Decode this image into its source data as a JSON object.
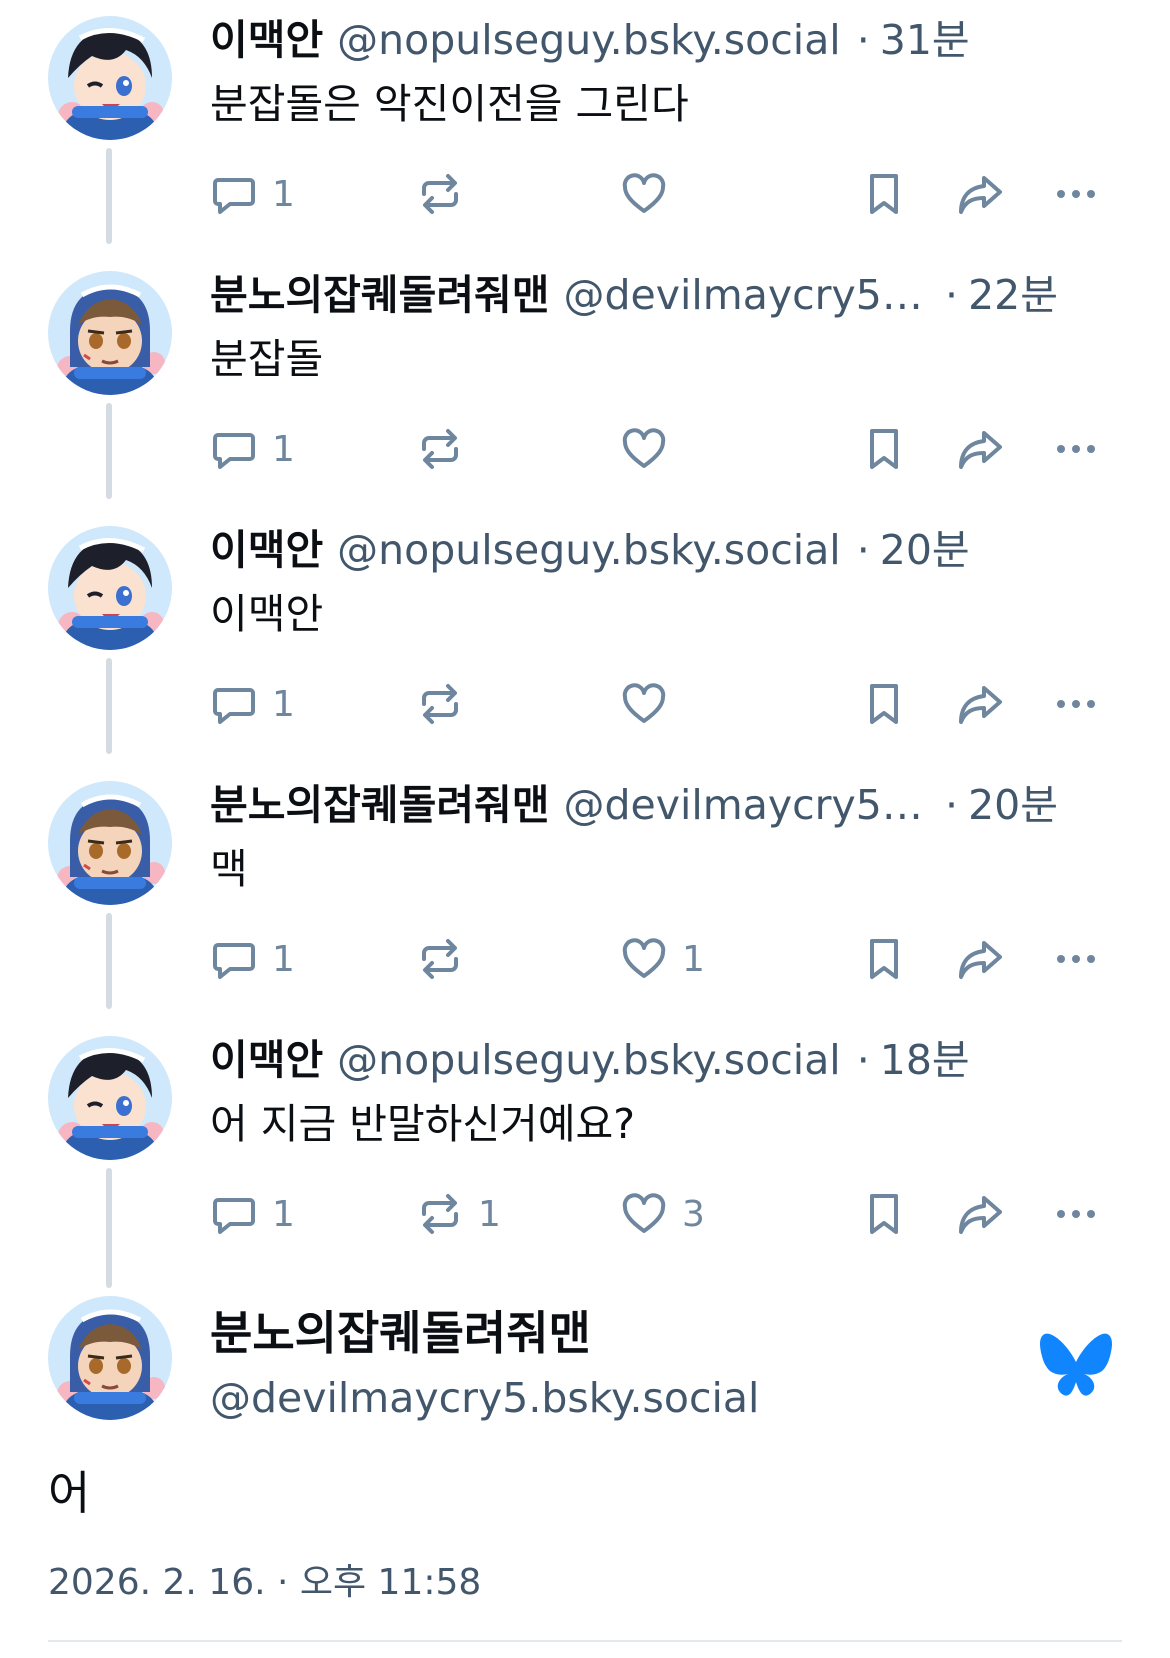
{
  "colors": {
    "text": "#0b0f14",
    "muted": "#42576c",
    "icon": "#6f869f",
    "rail": "#d4dbe2",
    "bluesky": "#1185fe"
  },
  "posts": [
    {
      "name": "이맥안",
      "handle": "@nopulseguy.bsky.social",
      "dot": "·",
      "time": "31분",
      "text": "분잡돌은 악진이전을 그린다",
      "reply_count": "1",
      "repost_count": "",
      "like_count": ""
    },
    {
      "name": "분노의잡퀘돌려줘맨",
      "handle": "@devilmaycry5.b...",
      "dot": "·",
      "time": "22분",
      "text": "분잡돌",
      "reply_count": "1",
      "repost_count": "",
      "like_count": ""
    },
    {
      "name": "이맥안",
      "handle": "@nopulseguy.bsky.social",
      "dot": "·",
      "time": "20분",
      "text": "이맥안",
      "reply_count": "1",
      "repost_count": "",
      "like_count": ""
    },
    {
      "name": "분노의잡퀘돌려줘맨",
      "handle": "@devilmaycry5.b...",
      "dot": "·",
      "time": "20분",
      "text": "맥",
      "reply_count": "1",
      "repost_count": "",
      "like_count": "1"
    },
    {
      "name": "이맥안",
      "handle": "@nopulseguy.bsky.social",
      "dot": "·",
      "time": "18분",
      "text": "어 지금 반말하신거예요?",
      "reply_count": "1",
      "repost_count": "1",
      "like_count": "3"
    }
  ],
  "focus_post": {
    "name": "분노의잡퀘돌려줘맨",
    "handle": "@devilmaycry5.bsky.social",
    "text": "어",
    "date": "2026. 2. 16. · 오후 11:58",
    "logo_icon": "bluesky-butterfly-icon"
  },
  "icons": {
    "reply": "speech-bubble-icon",
    "repost": "repost-arrows-icon",
    "like": "heart-icon",
    "save": "bookmark-icon",
    "share": "share-arrow-icon",
    "more": "ellipsis-icon"
  }
}
